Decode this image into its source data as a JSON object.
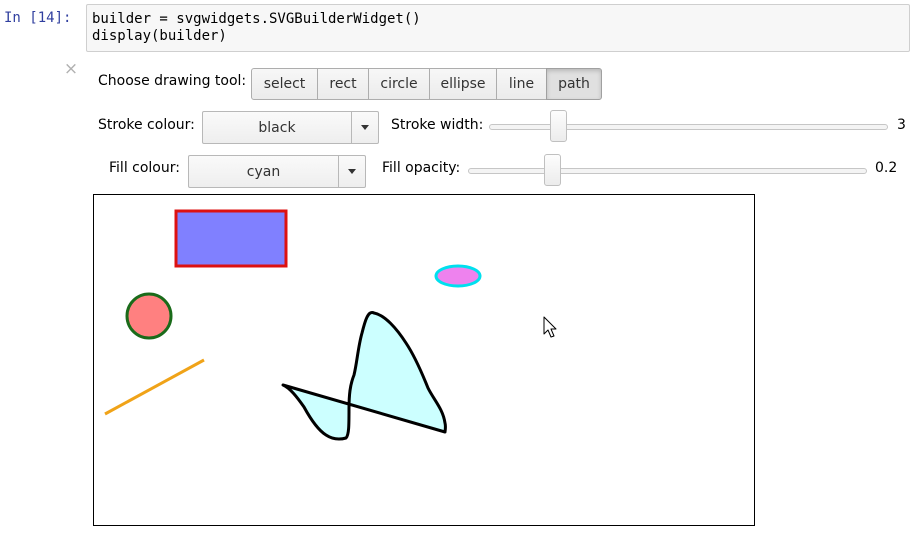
{
  "cell": {
    "prompt": "In [14]:",
    "code_lines": [
      "builder = svgwidgets.SVGBuilderWidget()",
      "display(builder)"
    ]
  },
  "output": {
    "close_symbol": "×"
  },
  "toolbar": {
    "label": "Choose drawing tool:",
    "tools": [
      "select",
      "rect",
      "circle",
      "ellipse",
      "line",
      "path"
    ],
    "selected_tool": "path"
  },
  "stroke": {
    "colour_label": "Stroke colour:",
    "colour_value": "black",
    "width_label": "Stroke width:",
    "width_value": "3",
    "width_fraction": 0.16
  },
  "fill": {
    "colour_label": "Fill colour:",
    "colour_value": "cyan",
    "opacity_label": "Fill opacity:",
    "opacity_value": "0.2",
    "opacity_fraction": 0.2
  },
  "drawing": {
    "shapes": [
      {
        "kind": "rect",
        "fill": "#8080ff",
        "stroke": "#dd1111"
      },
      {
        "kind": "circle",
        "fill": "#ff8080",
        "stroke": "#1a6b1a"
      },
      {
        "kind": "line",
        "stroke": "#f0a318"
      },
      {
        "kind": "ellipse",
        "fill": "#ee82ee",
        "stroke": "#00e0ee"
      },
      {
        "kind": "path",
        "fill": "#ccffff",
        "stroke": "#000000"
      }
    ],
    "cursor": "arrow-cursor"
  }
}
